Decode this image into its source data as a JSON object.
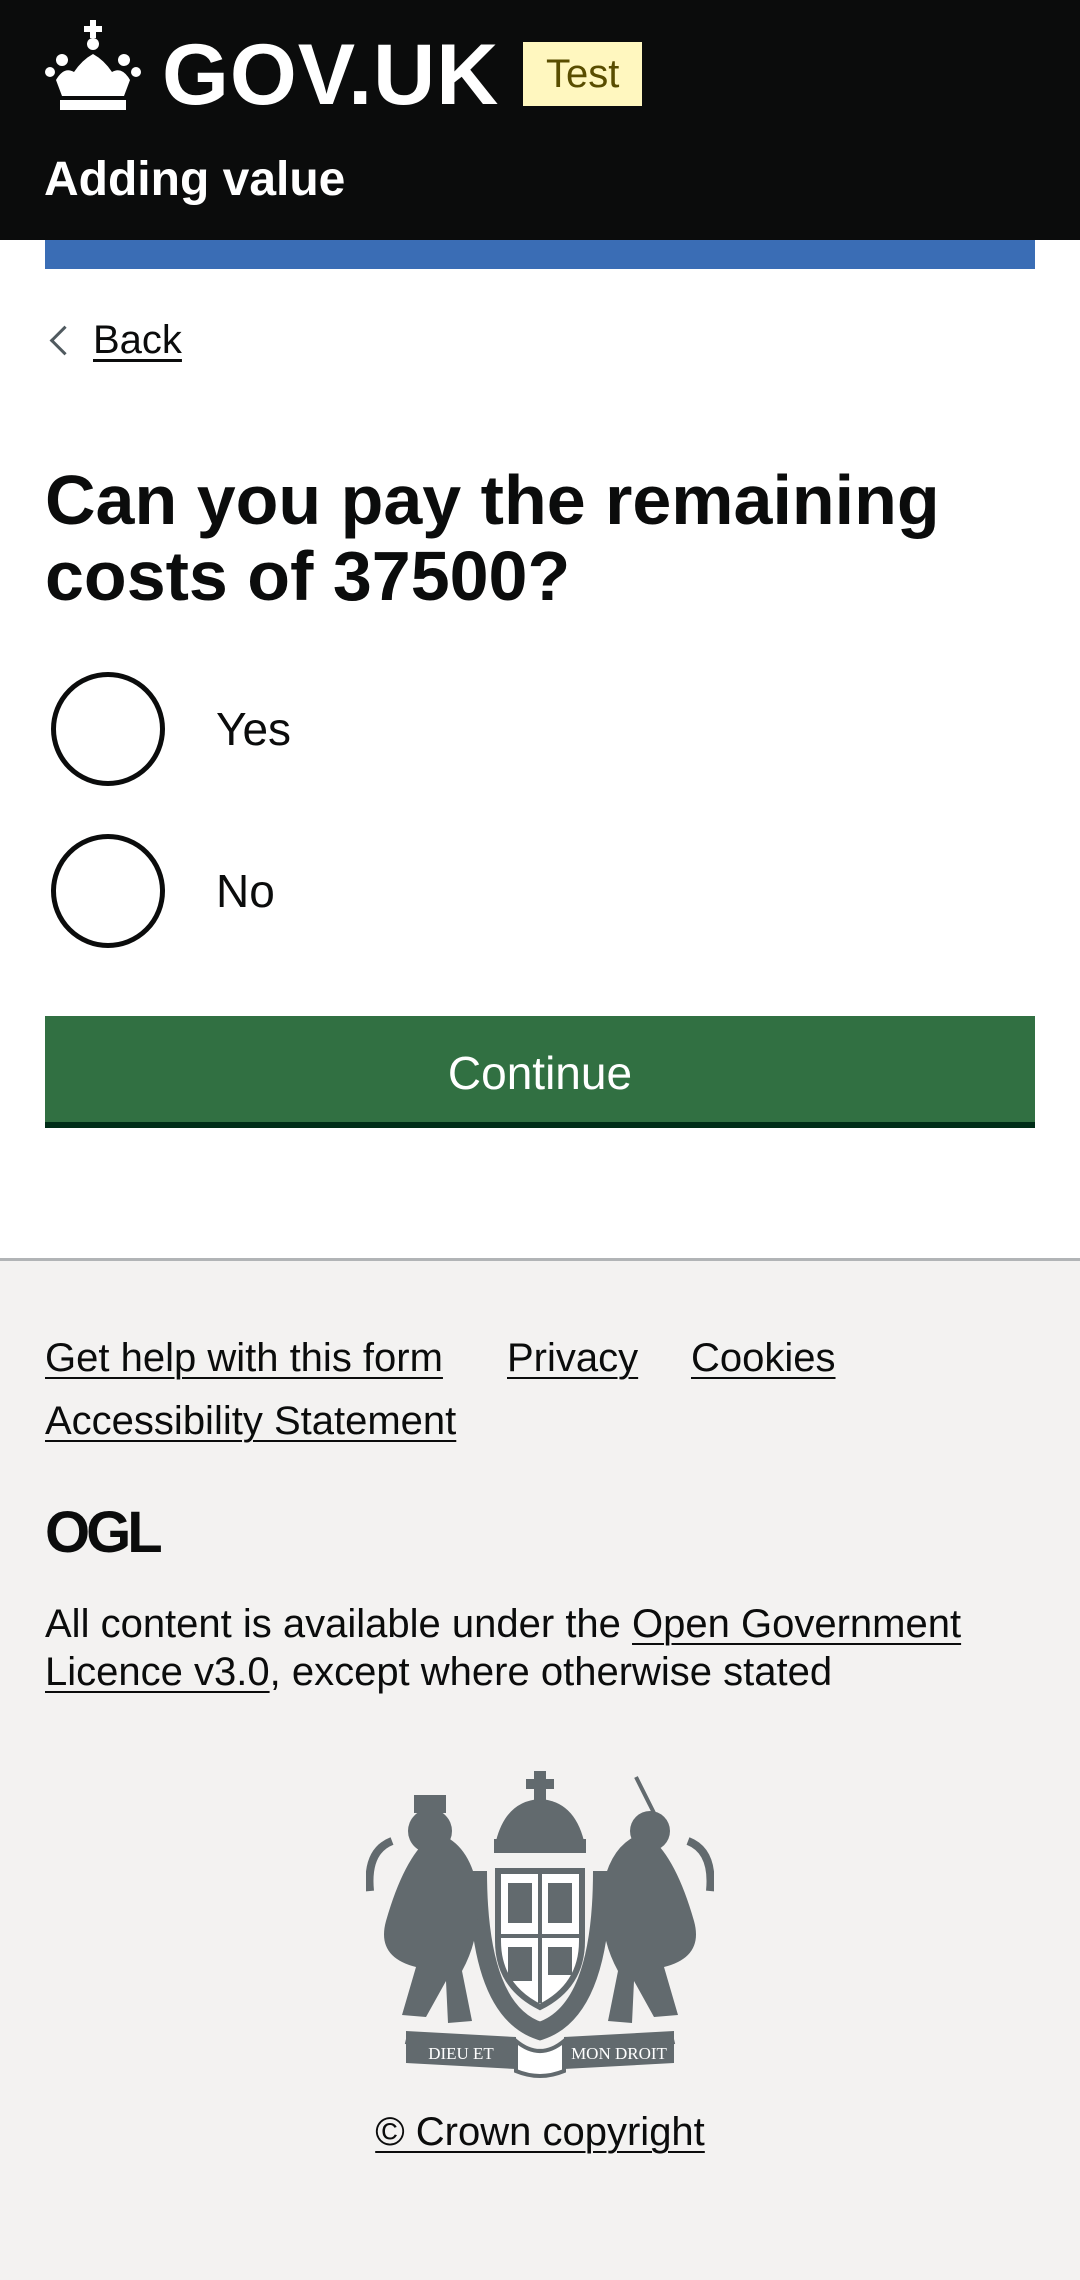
{
  "header": {
    "logo_text": "GOV.UK",
    "tag": "Test",
    "service_name": "Adding value"
  },
  "back_link": "Back",
  "question": "Can you pay the remaining costs of 37500?",
  "options": [
    {
      "label": "Yes"
    },
    {
      "label": "No"
    }
  ],
  "continue_label": "Continue",
  "footer": {
    "links": [
      "Get help with this form",
      "Privacy",
      "Cookies",
      "Accessibility Statement"
    ],
    "ogl_logo": "OGL",
    "licence_prefix": "All content is available under the ",
    "licence_link": "Open Government Licence v3.0",
    "licence_suffix": ", except where otherwise stated",
    "crest_mottos": [
      "DIEU ET",
      "MON DROIT"
    ],
    "copyright": "© Crown copyright"
  },
  "colors": {
    "header_bg": "#0b0c0c",
    "accent_blue": "#3a6db5",
    "tag_bg": "#fff7bf",
    "button_green": "#317042",
    "footer_bg": "#f3f2f1"
  }
}
